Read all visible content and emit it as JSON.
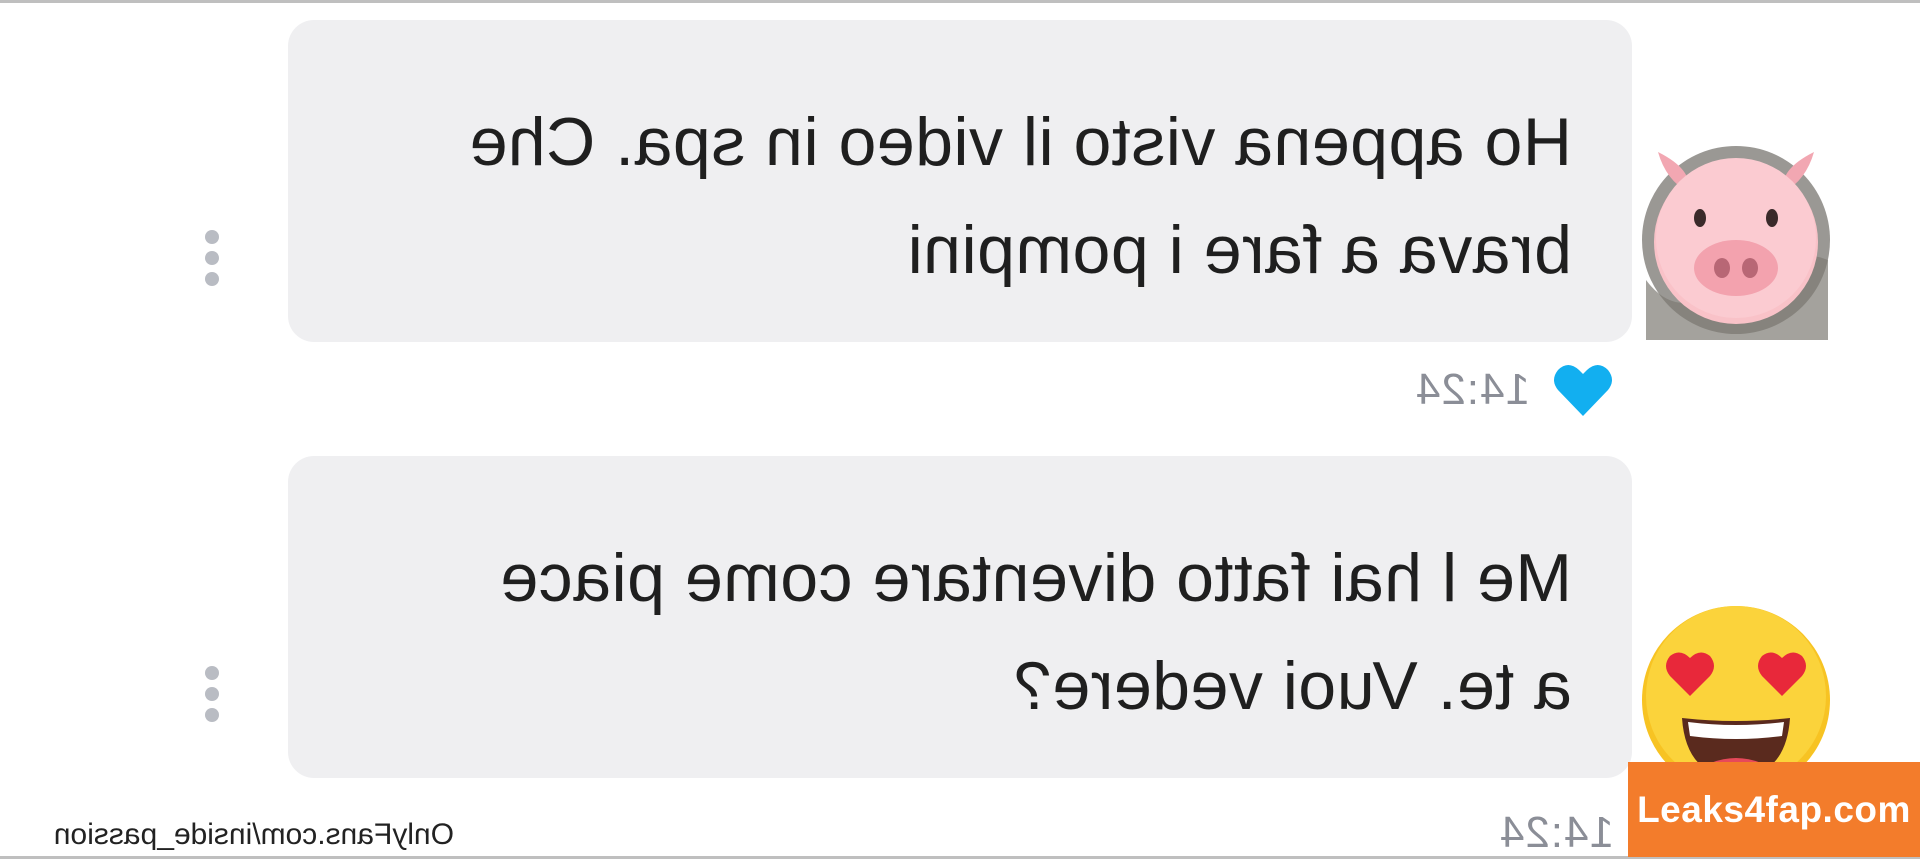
{
  "messages": [
    {
      "lines": [
        "Ho appena visto il video in spa. Che",
        "brava a fare i pompini"
      ],
      "time": "14:24",
      "liked": true,
      "avatar_icon": "pig-face-emoji"
    },
    {
      "lines": [
        "Me l hai fatto diventare come piace",
        "a te. Vuoi vedere?"
      ],
      "time": "14:24",
      "liked": false,
      "avatar_icon": "heart-eyes-emoji"
    }
  ],
  "footer": {
    "source_text": "OnlyFans.com/inside_passion",
    "brand_badge": "Leaks4fap.com"
  },
  "colors": {
    "bubble_bg": "#efeff1",
    "text": "#1f1f1f",
    "time": "#8b8e97",
    "like_heart": "#12aff0",
    "dots": "#b9bcc3",
    "badge_bg": "#f37c2b"
  }
}
